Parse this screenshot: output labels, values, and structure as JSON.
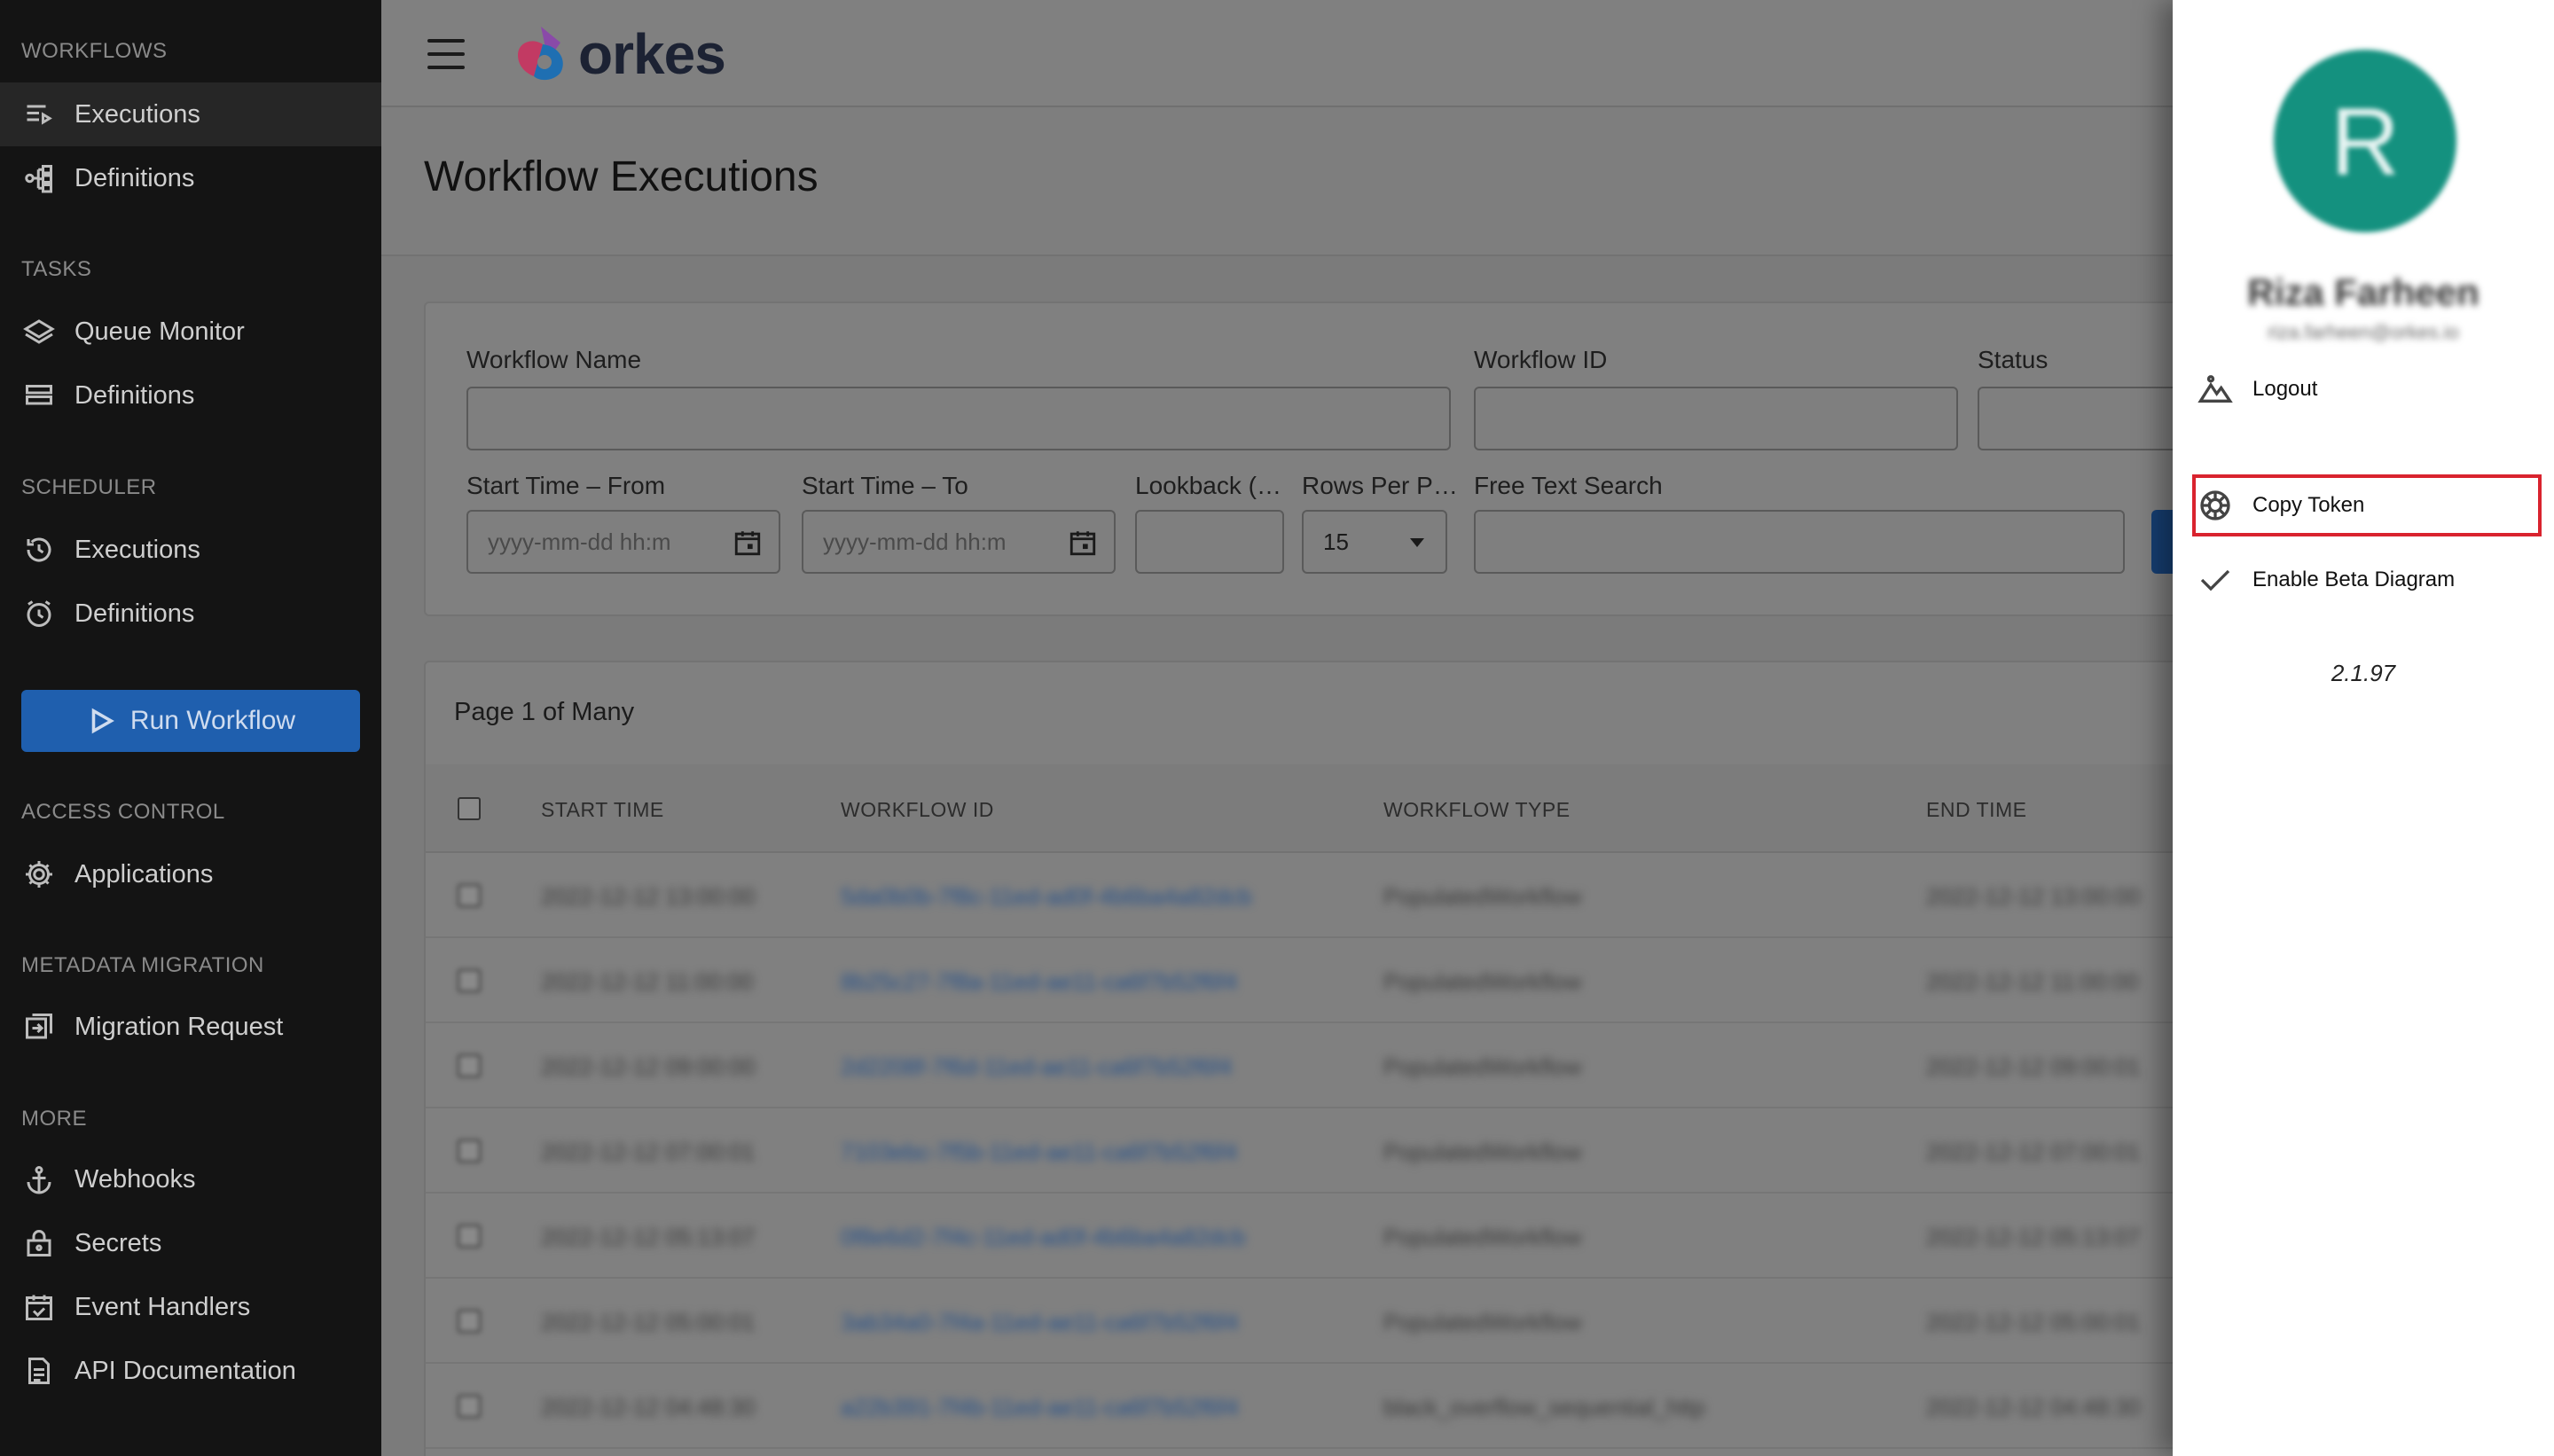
{
  "sidebar": {
    "sections": [
      {
        "title": "WORKFLOWS",
        "items": [
          {
            "label": "Executions",
            "icon": "executions-list-icon"
          },
          {
            "label": "Definitions",
            "icon": "workflow-tree-icon"
          }
        ]
      },
      {
        "title": "TASKS",
        "items": [
          {
            "label": "Queue Monitor",
            "icon": "layers-icon"
          },
          {
            "label": "Definitions",
            "icon": "stacked-list-icon"
          }
        ]
      },
      {
        "title": "SCHEDULER",
        "items": [
          {
            "label": "Executions",
            "icon": "history-icon"
          },
          {
            "label": "Definitions",
            "icon": "alarm-clock-icon"
          }
        ]
      },
      {
        "title": "ACCESS CONTROL",
        "items": [
          {
            "label": "Applications",
            "icon": "gear-icon"
          }
        ]
      },
      {
        "title": "METADATA MIGRATION",
        "items": [
          {
            "label": "Migration Request",
            "icon": "migration-icon"
          }
        ]
      },
      {
        "title": "MORE",
        "items": [
          {
            "label": "Webhooks",
            "icon": "anchor-icon"
          },
          {
            "label": "Secrets",
            "icon": "lock-icon"
          },
          {
            "label": "Event Handlers",
            "icon": "calendar-check-icon"
          },
          {
            "label": "API Documentation",
            "icon": "document-icon"
          }
        ]
      }
    ],
    "run_workflow_label": "Run Workflow"
  },
  "header": {
    "logo_text": "orkes"
  },
  "page": {
    "title": "Workflow Executions"
  },
  "filters": {
    "workflow_name_label": "Workflow Name",
    "workflow_id_label": "Workflow ID",
    "status_label": "Status",
    "start_from_label": "Start Time – From",
    "start_from_placeholder": "yyyy-mm-dd hh:m",
    "start_to_label": "Start Time – To",
    "start_to_placeholder": "yyyy-mm-dd hh:m",
    "lookback_label": "Lookback (…",
    "rows_per_page_label": "Rows Per P…",
    "rows_per_page_value": "15",
    "free_text_label": "Free Text Search"
  },
  "table": {
    "pager": "Page 1 of Many",
    "columns": [
      "START TIME",
      "WORKFLOW ID",
      "WORKFLOW TYPE",
      "END TIME"
    ],
    "rows": [
      {
        "start": "2022-12-12 13:00:00",
        "id": "5da0b0b-7f8c-11ed-ad0f-4b6ba4a82dcb",
        "type": "PopulatedWorkflow",
        "end": "2022-12-12 13:00:00"
      },
      {
        "start": "2022-12-12 11:00:00",
        "id": "8b25c27-7f8a-11ed-ae11-ca6f7b52f6f4",
        "type": "PopulatedWorkflow",
        "end": "2022-12-12 11:00:00"
      },
      {
        "start": "2022-12-12 09:00:00",
        "id": "2d2208f-7f6d-11ed-ae11-ca6f7b52f6f4",
        "type": "PopulatedWorkflow",
        "end": "2022-12-12 09:00:01"
      },
      {
        "start": "2022-12-12 07:00:01",
        "id": "7103ebc-7f5b-11ed-ae11-ca6f7b52f6f4",
        "type": "PopulatedWorkflow",
        "end": "2022-12-12 07:00:01"
      },
      {
        "start": "2022-12-12 05:13:07",
        "id": "0f8e6d2-7f4c-11ed-ad0f-4b6ba4a82dcb",
        "type": "PopulatedWorkflow",
        "end": "2022-12-12 05:13:07"
      },
      {
        "start": "2022-12-12 05:00:01",
        "id": "3ab34a0-7f4a-11ed-ae11-ca6f7b52f6f4",
        "type": "PopulatedWorkflow",
        "end": "2022-12-12 05:00:01"
      },
      {
        "start": "2022-12-12 04:48:30",
        "id": "a22b391-7f4b-11ed-ae11-ca6f7b52f6f4",
        "type": "black_overflow_sequential_http",
        "end": "2022-12-12 04:48:30"
      }
    ]
  },
  "user_panel": {
    "avatar_initial": "R",
    "user_name": "Riza Farheen",
    "user_email": "riza.farheen@orkes.io",
    "menu": [
      {
        "label": "Logout",
        "icon": "logout-mountain-icon"
      },
      {
        "label": "Copy Token",
        "icon": "settings-cog-icon"
      },
      {
        "label": "Enable Beta Diagram",
        "icon": "checkmark-icon"
      }
    ],
    "version": "2.1.97"
  },
  "colors": {
    "sidebar_bg": "#141414",
    "accent_blue": "#1f5fae",
    "avatar_teal": "#14917f",
    "highlight_red": "#d9232e",
    "overlay_gray": "#7b7b7b"
  }
}
